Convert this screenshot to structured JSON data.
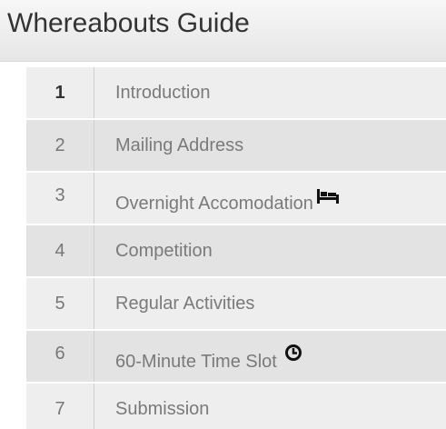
{
  "header": {
    "title": "Whereabouts Guide"
  },
  "nav": {
    "items": [
      {
        "number": "1",
        "label": "Introduction"
      },
      {
        "number": "2",
        "label": "Mailing Address"
      },
      {
        "number": "3",
        "label": "Overnight Accomodation",
        "icon": "bed-icon"
      },
      {
        "number": "4",
        "label": "Competition"
      },
      {
        "number": "5",
        "label": "Regular Activities"
      },
      {
        "number": "6",
        "label": "60-Minute Time Slot",
        "icon": "clock-icon"
      },
      {
        "number": "7",
        "label": "Submission"
      }
    ]
  },
  "colors": {
    "header_bg": "#ececec",
    "row_bg": "#eeeeee",
    "row_bg_alt": "#e3e3e3",
    "text_muted": "#7a7a7a",
    "text_dark": "#333333"
  }
}
